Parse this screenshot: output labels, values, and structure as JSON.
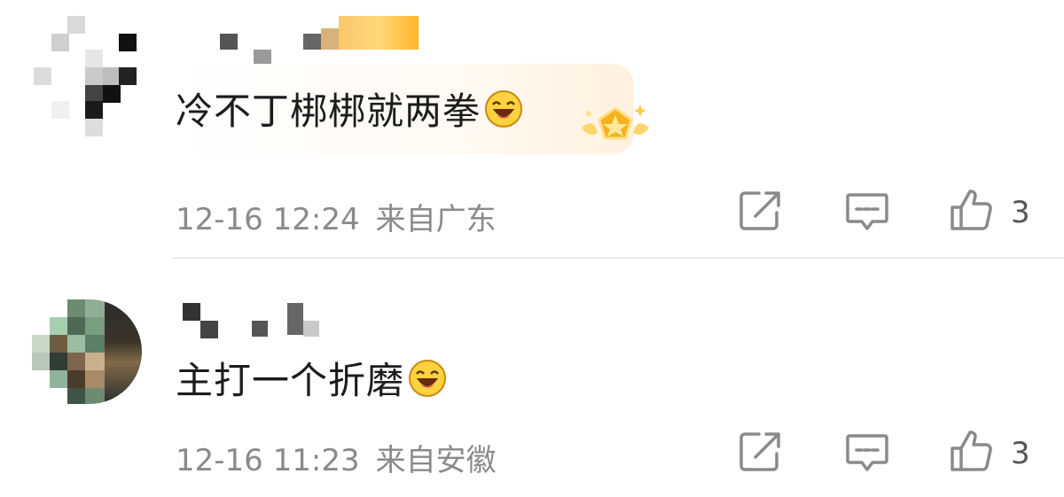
{
  "comments": [
    {
      "text": "冷不丁梆梆就两拳",
      "date": "12-16 12:24",
      "location": "来自广东",
      "likes": "3",
      "emoji_icon": "laughing-emoji-icon"
    },
    {
      "text": "主打一个折磨",
      "date": "12-16 11:23",
      "location": "来自安徽",
      "likes": "3",
      "emoji_icon": "laughing-emoji-icon"
    }
  ],
  "icons": {
    "share": "share-icon",
    "reply": "comment-icon",
    "like": "thumbs-up-icon",
    "badge": "fan-badge-icon"
  },
  "colors": {
    "accent_gold": "#f6b21d",
    "meta_gray": "#8a8a8a"
  }
}
